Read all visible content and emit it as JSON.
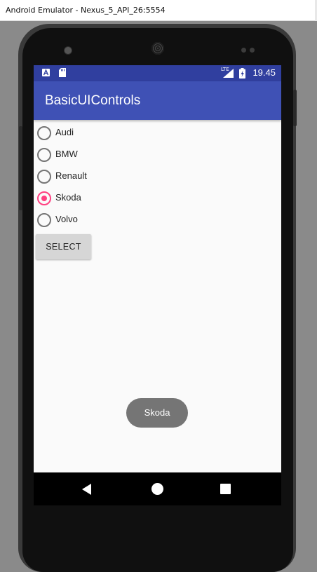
{
  "window": {
    "title": "Android Emulator - Nexus_5_API_26:5554"
  },
  "status_bar": {
    "time": "19.45",
    "network": "LTE"
  },
  "app": {
    "title": "BasicUIControls"
  },
  "radio_group": {
    "options": [
      {
        "label": "Audi",
        "checked": false
      },
      {
        "label": "BMW",
        "checked": false
      },
      {
        "label": "Renault",
        "checked": false
      },
      {
        "label": "Skoda",
        "checked": true
      },
      {
        "label": "Volvo",
        "checked": false
      }
    ],
    "accent_color": "#ff4081"
  },
  "select_button": {
    "label": "SELECT"
  },
  "toast": {
    "text": "Skoda"
  },
  "nav_bar": {
    "icons": [
      "back-icon",
      "home-icon",
      "recents-icon"
    ]
  },
  "colors": {
    "primary": "#3f51b5",
    "primary_dark": "#303f9f"
  }
}
